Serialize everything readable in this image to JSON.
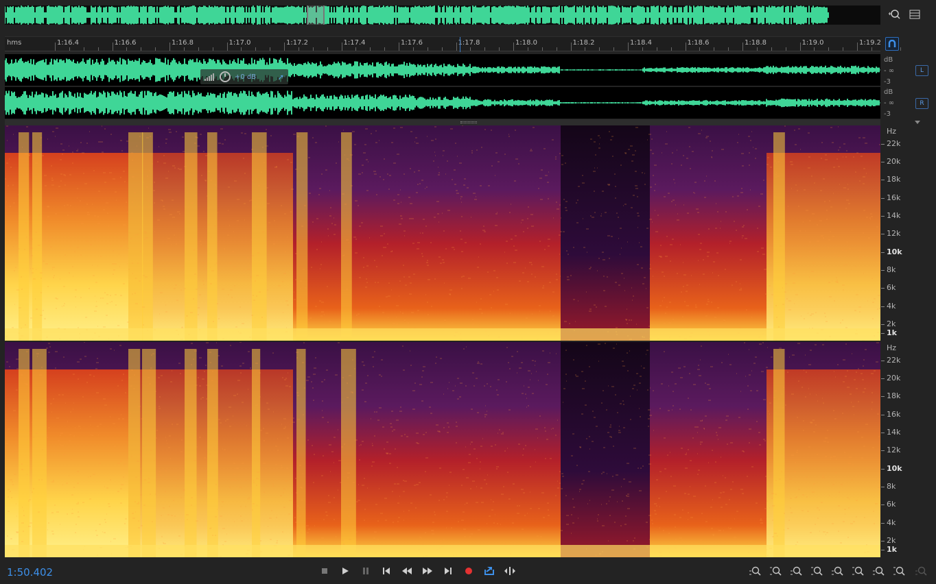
{
  "colors": {
    "waveform": "#3fd697",
    "accent_blue": "#3d8fe8",
    "record_red": "#e53232",
    "background": "#232323"
  },
  "ruler": {
    "unit": "hms",
    "ticks": [
      "1:16.4",
      "1:16.6",
      "1:16.8",
      "1:17.0",
      "1:17.2",
      "1:17.4",
      "1:17.6",
      "1:17.8",
      "1:18.0",
      "1:18.2",
      "1:18.4",
      "1:18.6",
      "1:18.8",
      "1:19.0",
      "1:19.2"
    ]
  },
  "waveform": {
    "left": {
      "channel_label": "L",
      "db_labels": [
        "dB",
        "- ∞",
        "-3"
      ]
    },
    "right": {
      "channel_label": "R",
      "db_labels": [
        "dB",
        "- ∞",
        "-3"
      ]
    },
    "hud": {
      "gain": "+0 dB"
    }
  },
  "spectral": {
    "unit": "Hz",
    "freq_labels": [
      "22k",
      "20k",
      "18k",
      "16k",
      "14k",
      "12k",
      "10k",
      "8k",
      "6k",
      "4k",
      "2k",
      "1k"
    ],
    "bold_labels": [
      "10k",
      "1k"
    ]
  },
  "transport": {
    "current_time": "1:50.402",
    "buttons": [
      "stop-icon",
      "play-icon",
      "pause-icon",
      "skip-to-start-icon",
      "rewind-icon",
      "fast-forward-icon",
      "skip-to-end-icon",
      "record-icon",
      "loop-icon",
      "skip-selection-icon"
    ]
  },
  "zoom": {
    "buttons": [
      "zoom-in-amplitude-icon",
      "zoom-out-amplitude-icon",
      "zoom-in-time-icon",
      "zoom-out-time-icon",
      "zoom-full-icon",
      "zoom-in-left-icon",
      "zoom-in-right-icon",
      "zoom-out-full-icon",
      "zoom-to-selection-icon"
    ]
  }
}
